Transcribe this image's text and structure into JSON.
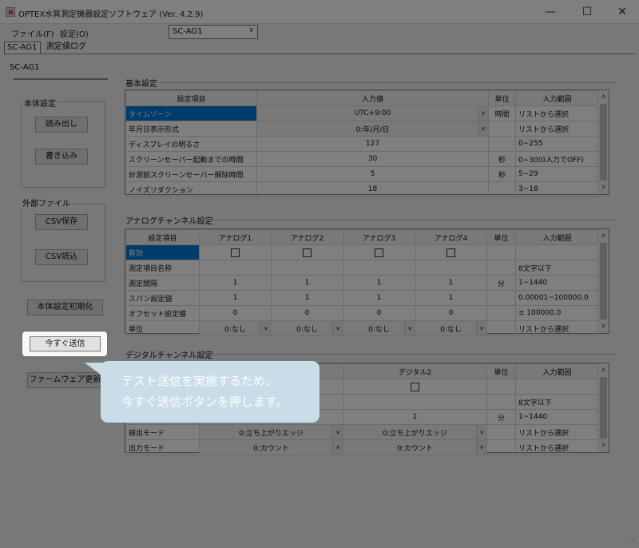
{
  "window": {
    "title": "OPTEX水質測定機器設定ソフトウェア (Ver. 4.2.9)",
    "min": "—",
    "max": "☐",
    "close": "✕"
  },
  "menu": {
    "file": "ファイル(F)",
    "settings": "設定(O)"
  },
  "device_select": {
    "value": "SC-AG1",
    "arrow": "∨"
  },
  "tabs": [
    "SC-AG1",
    "測定値ログ"
  ],
  "device_label": "SC-AG1",
  "sidebar": {
    "body_settings": {
      "title": "本体設定",
      "read": "読み出し",
      "write": "書き込み"
    },
    "external_file": {
      "title": "外部ファイル",
      "csv_save": "CSV保存",
      "csv_load": "CSV読込"
    },
    "reset": "本体設定初期化",
    "send_now": "今すぐ送信",
    "firmware": "ファームウェア更新"
  },
  "basic": {
    "title": "基本設定",
    "headers": [
      "設定項目",
      "入力値",
      "単位",
      "入力範囲"
    ],
    "rows": [
      {
        "item": "タイムゾーン",
        "value": "UTC+9:00",
        "unit": "時間",
        "range": "リストから選択"
      },
      {
        "item": "年月日表示形式",
        "value": "0:年/月/日",
        "unit": "",
        "range": "リストから選択"
      },
      {
        "item": "ディスプレイの明るさ",
        "value": "127",
        "unit": "",
        "range": "0~255"
      },
      {
        "item": "スクリーンセーバー起動までの時間",
        "value": "30",
        "unit": "秒",
        "range": "0~30(0入力でOFF)"
      },
      {
        "item": "計測前スクリーンセーバー解除時間",
        "value": "5",
        "unit": "秒",
        "range": "5~29"
      },
      {
        "item": "ノイズリダクション",
        "value": "18",
        "unit": "",
        "range": "3~18"
      }
    ]
  },
  "analog": {
    "title": "アナログチャンネル設定",
    "headers": [
      "設定項目",
      "アナログ1",
      "アナログ2",
      "アナログ3",
      "アナログ4",
      "単位",
      "入力範囲"
    ],
    "rows": [
      {
        "item": "有効",
        "cells": [
          "",
          "",
          "",
          ""
        ],
        "unit": "",
        "range": ""
      },
      {
        "item": "測定項目名称",
        "cells": [
          "",
          "",
          "",
          ""
        ],
        "unit": "",
        "range": "8文字以下"
      },
      {
        "item": "測定間隔",
        "cells": [
          "1",
          "1",
          "1",
          "1"
        ],
        "unit": "分",
        "range": "1~1440"
      },
      {
        "item": "スパン設定値",
        "cells": [
          "1",
          "1",
          "1",
          "1"
        ],
        "unit": "",
        "range": "0.00001~100000.0"
      },
      {
        "item": "オフセット設定値",
        "cells": [
          "0",
          "0",
          "0",
          "0"
        ],
        "unit": "",
        "range": "± 100000.0"
      },
      {
        "item": "単位",
        "cells": [
          "0:なし",
          "0:なし",
          "0:なし",
          "0:なし"
        ],
        "unit": "",
        "range": "リストから選択"
      }
    ]
  },
  "digital": {
    "title": "デジタルチャンネル設定",
    "headers": [
      "",
      "",
      "デジタル2",
      "単位",
      "入力範囲"
    ],
    "rows": [
      {
        "item": "",
        "d1": "",
        "d2": "",
        "unit": "",
        "range": ""
      },
      {
        "item": "",
        "d1": "",
        "d2": "",
        "unit": "",
        "range": "8文字以下"
      },
      {
        "item": "",
        "d1": "",
        "d2": "1",
        "unit": "分",
        "range": "1~1440"
      },
      {
        "item": "検出モード",
        "d1": "0:立ち上がりエッジ",
        "d2": "0:立ち上がりエッジ",
        "unit": "",
        "range": "リストから選択"
      },
      {
        "item": "出力モード",
        "d1": "0:カウント",
        "d2": "0:カウント",
        "unit": "",
        "range": "リストから選択"
      }
    ]
  },
  "callout": {
    "line1": "テスト送信を実施するため、",
    "line2": "今すぐ送信ボタンを押します。"
  },
  "icons": {
    "dropdown": "∨",
    "scroll_up": "∧",
    "scroll_down": "∨",
    "grip": "⋰"
  }
}
